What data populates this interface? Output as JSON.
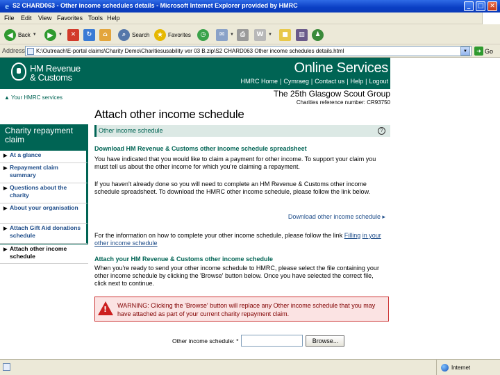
{
  "window": {
    "title": "S2 CHARD063 - Other income schedules details - Microsoft Internet Explorer provided by HMRC",
    "controls": [
      "_",
      "□",
      "✕"
    ]
  },
  "menu": [
    "File",
    "Edit",
    "View",
    "Favorites",
    "Tools",
    "Help"
  ],
  "toolbar": {
    "back_label": "Back",
    "search_label": "Search",
    "favorites_label": "Favorites"
  },
  "address": {
    "label": "Address",
    "url": "K:\\Outreach\\E-portal claims\\Charity Demo\\Charitiesusability ver 03 B.zip\\S2 CHARD063     Other income schedules details.html",
    "go_label": "Go"
  },
  "header": {
    "brand_line1": "HM Revenue",
    "brand_line2": "& Customs",
    "online_services": "Online Services",
    "nav": [
      "HMRC Home",
      "Cymraeg",
      "Contact us",
      "Help",
      "Logout"
    ]
  },
  "your_services": "▲ Your HMRC services",
  "organisation": {
    "name": "The 25th Glasgow Scout Group",
    "charity_ref": "Charities reference number: CR93750"
  },
  "leftnav": {
    "heading": "Charity repayment claim",
    "items": [
      "At a glance",
      "Repayment claim summary",
      "Questions about the charity",
      "About your organisation",
      "Attach Gift Aid donations schedule",
      "Attach other income schedule"
    ]
  },
  "main": {
    "title": "Attach other income schedule",
    "section_label": "Other income schedule",
    "help_icon": "?",
    "download_heading": "Download HM Revenue & Customs other income schedule spreadsheet",
    "para1": "You have indicated that you would like to claim a payment for other income. To support your claim you must tell us about the other income for which you're claiming a repayment.",
    "para2": "If you haven't already done so you will need to complete an HM Revenue & Customs other income schedule spreadsheet. To download the HMRC other income schedule, please follow the link below.",
    "download_link": "Download other income schedule ▸",
    "para3_prefix": "For the information on how to complete your other income schedule, please follow the link ",
    "para3_link_a": "Filling",
    "para3_link_b": "in your other income schedule",
    "attach_heading": "Attach your HM Revenue & Customs other income schedule",
    "para4": "When you're ready to send your other income schedule to HMRC, please select the file containing your other income schedule by clicking the 'Browse' button below. Once you have selected the correct file, click next to continue.",
    "warning": "WARNING: Clicking the 'Browse' button will replace any Other income schedule that you may have attached as part of your current charity repayment claim.",
    "file_label": "Other income schedule: *",
    "browse_label": "Browse..."
  },
  "status": {
    "zone": "Internet"
  }
}
